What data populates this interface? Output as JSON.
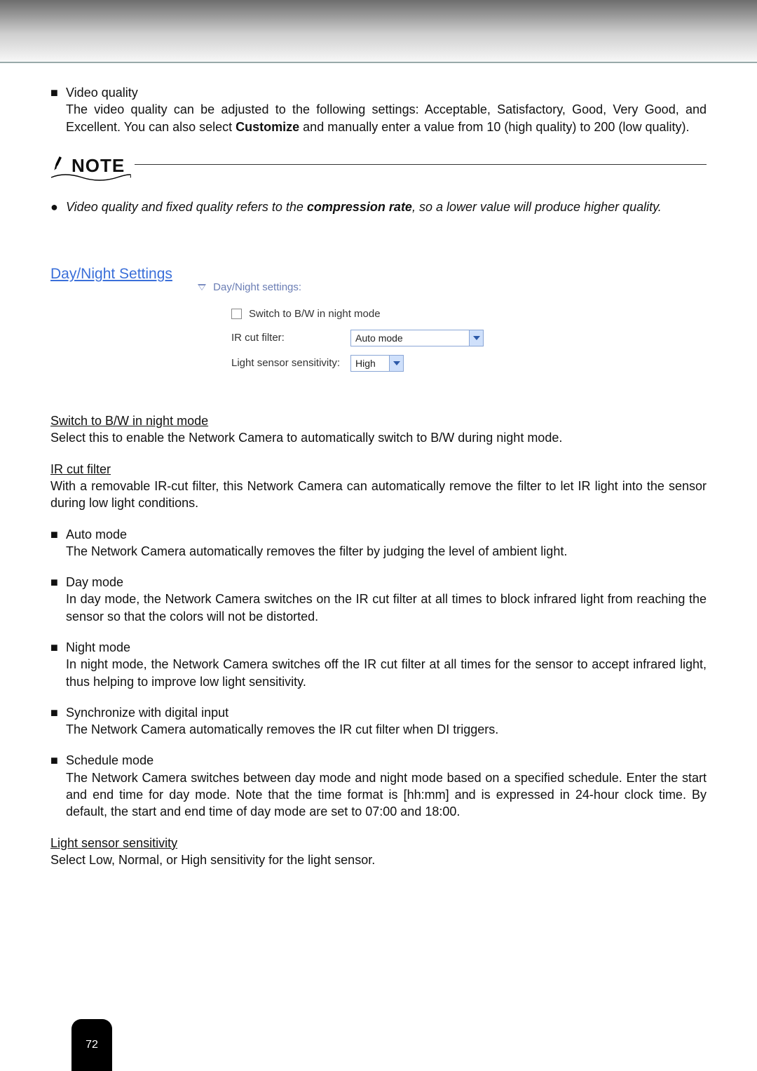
{
  "video_quality": {
    "title": "Video quality",
    "body_before": "The video quality can be adjusted to the following settings: Acceptable, Satisfactory, Good, Very Good, and Excellent. You can also select ",
    "body_bold": "Customize",
    "body_after": " and manually enter a value from 10 (high quality) to 200 (low quality)."
  },
  "note": {
    "label": "NOTE",
    "bullet_before": "Video quality and fixed quality refers to the ",
    "bullet_bold": "compression rate",
    "bullet_after": ", so a lower value will produce higher quality."
  },
  "section_link": "Day/Night Settings",
  "settings_panel": {
    "header": "Day/Night settings:",
    "checkbox_label": "Switch to B/W in night mode",
    "ir_label": "IR cut filter:",
    "ir_value": "Auto mode",
    "sens_label": "Light sensor sensitivity:",
    "sens_value": "High"
  },
  "switch_bw": {
    "title": "Switch to B/W in night mode",
    "body": "Select this to enable the Network Camera to automatically switch to B/W during night mode."
  },
  "ir_filter": {
    "title": "IR cut filter",
    "body": "With a removable IR-cut filter, this Network Camera can automatically remove the filter to let IR light into the sensor during low light conditions."
  },
  "modes": {
    "auto": {
      "title": "Auto mode",
      "body": "The Network Camera automatically removes the filter by judging the level of ambient light."
    },
    "day": {
      "title": "Day mode",
      "body": "In day mode, the Network Camera switches on the IR cut filter at all times to block infrared light from reaching the sensor so that the colors will not be distorted."
    },
    "night": {
      "title": "Night mode",
      "body": "In night mode, the Network Camera switches off the IR cut filter at all times for the sensor to accept infrared light, thus helping to improve low light sensitivity."
    },
    "sync": {
      "title": "Synchronize with digital input",
      "body": "The Network Camera automatically removes the IR cut filter when DI triggers."
    },
    "schedule": {
      "title": "Schedule mode",
      "body": "The Network Camera switches between day mode and night mode based on a specified schedule. Enter the start and end time for day mode. Note that the time format is [hh:mm] and is expressed in 24-hour clock time. By default, the start and end time of day mode are set to 07:00 and 18:00."
    }
  },
  "light_sensor": {
    "title": "Light sensor sensitivity",
    "body": "Select Low, Normal, or High sensitivity for the light sensor."
  },
  "page_number": "72"
}
